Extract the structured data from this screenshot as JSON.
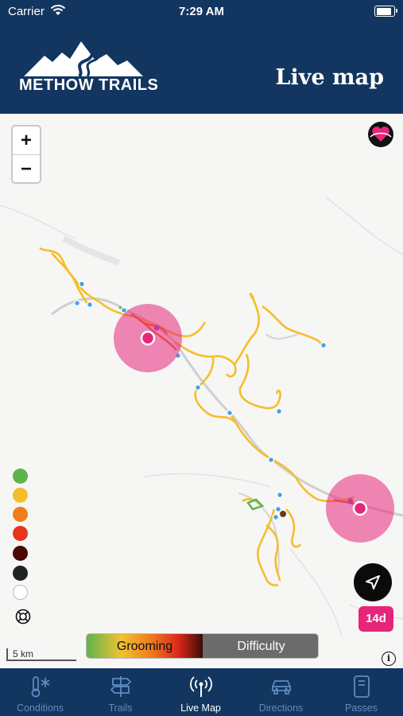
{
  "status_bar": {
    "carrier": "Carrier",
    "time": "7:29 AM",
    "battery_level": 0.95
  },
  "header": {
    "logo_text": "METHOW TRAILS",
    "title": "Live map"
  },
  "map": {
    "zoom_in_label": "+",
    "zoom_out_label": "−",
    "legend_colors": [
      "#5fb34a",
      "#f6bd2b",
      "#ef7d1f",
      "#e8341c",
      "#4a0a08",
      "#222222",
      "#ffffff"
    ],
    "locate_icon": "navigation-arrow-icon",
    "favorite_icon": "heart-badge-icon",
    "range_label": "14d",
    "range_color": "#e6267a",
    "scale_label": "5 km",
    "info_label": "i",
    "toggle": {
      "grooming_label": "Grooming",
      "difficulty_label": "Difficulty",
      "active": "grooming"
    }
  },
  "colors": {
    "header_bg": "#12365f",
    "tab_active": "#ffffff",
    "tab_inactive": "#5f8ac2",
    "trail_yellow": "#f6bd2b",
    "hotspot": "#e6267a"
  },
  "tabs": [
    {
      "label": "Conditions",
      "icon": "thermometer-snowflake-icon",
      "active": false
    },
    {
      "label": "Trails",
      "icon": "signpost-icon",
      "active": false
    },
    {
      "label": "Live Map",
      "icon": "broadcast-antenna-icon",
      "active": true
    },
    {
      "label": "Directions",
      "icon": "car-icon",
      "active": false
    },
    {
      "label": "Passes",
      "icon": "pass-card-icon",
      "active": false
    }
  ]
}
